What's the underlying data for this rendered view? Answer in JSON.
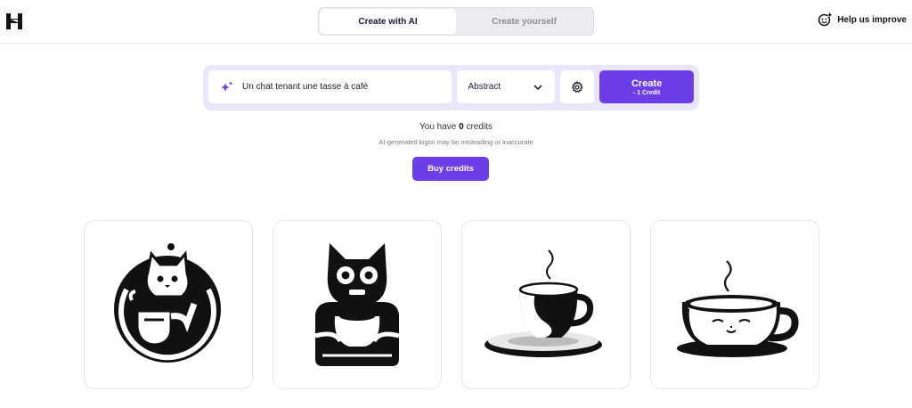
{
  "header": {
    "logo_icon": "h-logo-icon",
    "tabs": [
      {
        "label": "Create with AI",
        "active": true
      },
      {
        "label": "Create yourself",
        "active": false
      }
    ],
    "help_label": "Help us improve",
    "help_icon": "smiley-plus-icon"
  },
  "prompt": {
    "value": "Un chat tenant une tasse à café",
    "icon": "sparkle-icon"
  },
  "style_select": {
    "value": "Abstract",
    "icon": "chevron-down-icon"
  },
  "settings": {
    "icon": "gear-icon"
  },
  "create_button": {
    "label": "Create",
    "cost": "- 1 Credit"
  },
  "credits": {
    "prefix": "You have",
    "count": "0",
    "suffix": "credits"
  },
  "disclaimer": "AI-generated logos may be misleading or inaccurate",
  "buy_button": "Buy credits",
  "results": [
    {
      "name": "cat-circle-logo"
    },
    {
      "name": "cat-holding-cup-logo"
    },
    {
      "name": "coffee-cup-saucer-logo"
    },
    {
      "name": "cat-face-cup-logo"
    }
  ],
  "colors": {
    "accent": "#6c3ee8",
    "prompt_bar_bg": "#e9e6fb"
  }
}
